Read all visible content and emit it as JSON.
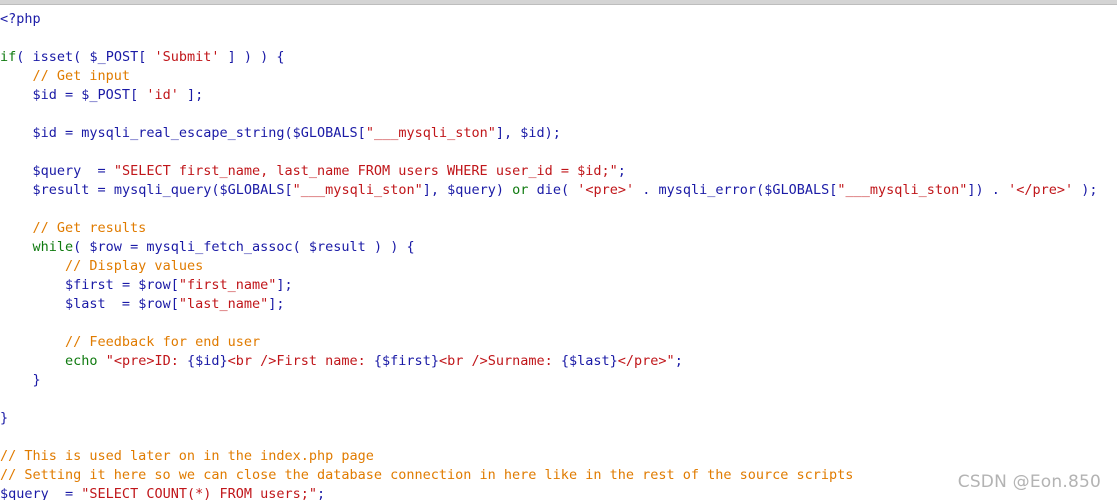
{
  "editor": {
    "lines": [
      [
        {
          "t": "<?php",
          "c": "punc"
        }
      ],
      [],
      [
        {
          "t": "if",
          "c": "kw"
        },
        {
          "t": "( ",
          "c": "punc"
        },
        {
          "t": "isset",
          "c": "fn"
        },
        {
          "t": "( ",
          "c": "punc"
        },
        {
          "t": "$_POST",
          "c": "var"
        },
        {
          "t": "[ ",
          "c": "punc"
        },
        {
          "t": "'Submit'",
          "c": "str"
        },
        {
          "t": " ] ) ) {",
          "c": "punc"
        }
      ],
      [
        {
          "t": "    ",
          "c": "punc"
        },
        {
          "t": "// Get input",
          "c": "cmt"
        }
      ],
      [
        {
          "t": "    ",
          "c": "punc"
        },
        {
          "t": "$id",
          "c": "var"
        },
        {
          "t": " = ",
          "c": "punc"
        },
        {
          "t": "$_POST",
          "c": "var"
        },
        {
          "t": "[ ",
          "c": "punc"
        },
        {
          "t": "'id'",
          "c": "str"
        },
        {
          "t": " ];",
          "c": "punc"
        }
      ],
      [],
      [
        {
          "t": "    ",
          "c": "punc"
        },
        {
          "t": "$id",
          "c": "var"
        },
        {
          "t": " = ",
          "c": "punc"
        },
        {
          "t": "mysqli_real_escape_string",
          "c": "fn"
        },
        {
          "t": "(",
          "c": "punc"
        },
        {
          "t": "$GLOBALS",
          "c": "var"
        },
        {
          "t": "[",
          "c": "punc"
        },
        {
          "t": "\"___mysqli_ston\"",
          "c": "str"
        },
        {
          "t": "], ",
          "c": "punc"
        },
        {
          "t": "$id",
          "c": "var"
        },
        {
          "t": ");",
          "c": "punc"
        }
      ],
      [],
      [
        {
          "t": "    ",
          "c": "punc"
        },
        {
          "t": "$query",
          "c": "var"
        },
        {
          "t": "  = ",
          "c": "punc"
        },
        {
          "t": "\"SELECT first_name, last_name FROM users WHERE user_id = $id;\"",
          "c": "str"
        },
        {
          "t": ";",
          "c": "punc"
        }
      ],
      [
        {
          "t": "    ",
          "c": "punc"
        },
        {
          "t": "$result",
          "c": "var"
        },
        {
          "t": " = ",
          "c": "punc"
        },
        {
          "t": "mysqli_query",
          "c": "fn"
        },
        {
          "t": "(",
          "c": "punc"
        },
        {
          "t": "$GLOBALS",
          "c": "var"
        },
        {
          "t": "[",
          "c": "punc"
        },
        {
          "t": "\"___mysqli_ston\"",
          "c": "str"
        },
        {
          "t": "], ",
          "c": "punc"
        },
        {
          "t": "$query",
          "c": "var"
        },
        {
          "t": ") ",
          "c": "punc"
        },
        {
          "t": "or",
          "c": "kw"
        },
        {
          "t": " ",
          "c": "punc"
        },
        {
          "t": "die",
          "c": "fn"
        },
        {
          "t": "( ",
          "c": "punc"
        },
        {
          "t": "'<pre>'",
          "c": "str"
        },
        {
          "t": " . ",
          "c": "punc"
        },
        {
          "t": "mysqli_error",
          "c": "fn"
        },
        {
          "t": "(",
          "c": "punc"
        },
        {
          "t": "$GLOBALS",
          "c": "var"
        },
        {
          "t": "[",
          "c": "punc"
        },
        {
          "t": "\"___mysqli_ston\"",
          "c": "str"
        },
        {
          "t": "]) . ",
          "c": "punc"
        },
        {
          "t": "'</pre>'",
          "c": "str"
        },
        {
          "t": " );",
          "c": "punc"
        }
      ],
      [],
      [
        {
          "t": "    ",
          "c": "punc"
        },
        {
          "t": "// Get results",
          "c": "cmt"
        }
      ],
      [
        {
          "t": "    ",
          "c": "punc"
        },
        {
          "t": "while",
          "c": "kw"
        },
        {
          "t": "( ",
          "c": "punc"
        },
        {
          "t": "$row",
          "c": "var"
        },
        {
          "t": " = ",
          "c": "punc"
        },
        {
          "t": "mysqli_fetch_assoc",
          "c": "fn"
        },
        {
          "t": "( ",
          "c": "punc"
        },
        {
          "t": "$result",
          "c": "var"
        },
        {
          "t": " ) ) {",
          "c": "punc"
        }
      ],
      [
        {
          "t": "        ",
          "c": "punc"
        },
        {
          "t": "// Display values",
          "c": "cmt"
        }
      ],
      [
        {
          "t": "        ",
          "c": "punc"
        },
        {
          "t": "$first",
          "c": "var"
        },
        {
          "t": " = ",
          "c": "punc"
        },
        {
          "t": "$row",
          "c": "var"
        },
        {
          "t": "[",
          "c": "punc"
        },
        {
          "t": "\"first_name\"",
          "c": "str"
        },
        {
          "t": "];",
          "c": "punc"
        }
      ],
      [
        {
          "t": "        ",
          "c": "punc"
        },
        {
          "t": "$last",
          "c": "var"
        },
        {
          "t": "  = ",
          "c": "punc"
        },
        {
          "t": "$row",
          "c": "var"
        },
        {
          "t": "[",
          "c": "punc"
        },
        {
          "t": "\"last_name\"",
          "c": "str"
        },
        {
          "t": "];",
          "c": "punc"
        }
      ],
      [],
      [
        {
          "t": "        ",
          "c": "punc"
        },
        {
          "t": "// Feedback for end user",
          "c": "cmt"
        }
      ],
      [
        {
          "t": "        ",
          "c": "punc"
        },
        {
          "t": "echo",
          "c": "kw"
        },
        {
          "t": " ",
          "c": "punc"
        },
        {
          "t": "\"<pre>ID: ",
          "c": "str"
        },
        {
          "t": "{$id}",
          "c": "var"
        },
        {
          "t": "<br />First name: ",
          "c": "str"
        },
        {
          "t": "{$first}",
          "c": "var"
        },
        {
          "t": "<br />Surname: ",
          "c": "str"
        },
        {
          "t": "{$last}",
          "c": "var"
        },
        {
          "t": "</pre>\"",
          "c": "str"
        },
        {
          "t": ";",
          "c": "punc"
        }
      ],
      [
        {
          "t": "    }",
          "c": "punc"
        }
      ],
      [],
      [
        {
          "t": "}",
          "c": "punc"
        }
      ],
      [],
      [
        {
          "t": "// This is used later on in the index.php page",
          "c": "cmt"
        }
      ],
      [
        {
          "t": "// Setting it here so we can close the database connection in here like in the rest of the source scripts",
          "c": "cmt"
        }
      ],
      [
        {
          "t": "$query",
          "c": "var"
        },
        {
          "t": "  = ",
          "c": "punc"
        },
        {
          "t": "\"SELECT COUNT(*) FROM users;\"",
          "c": "str"
        },
        {
          "t": ";",
          "c": "punc"
        }
      ]
    ]
  },
  "watermark": {
    "text": "CSDN @Eon.850"
  },
  "colors": {
    "keyword": "#0f7a0f",
    "variable": "#1a1aa6",
    "string": "#c0161a",
    "comment": "#e07b00",
    "background": "#ffffff"
  }
}
